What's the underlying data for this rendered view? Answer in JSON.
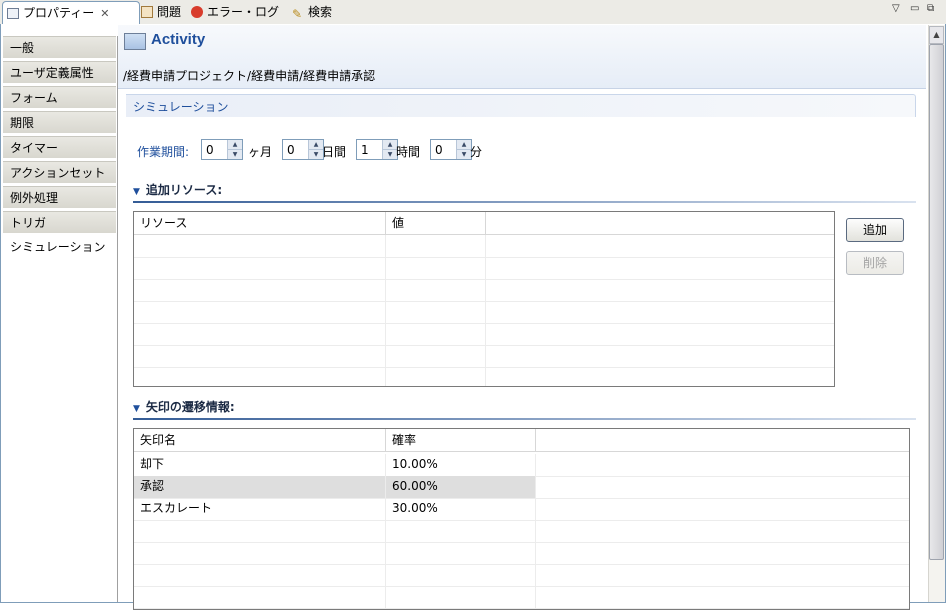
{
  "tabs": [
    {
      "label": "プロパティー",
      "icon": "properties-icon",
      "active": true,
      "closable": true
    },
    {
      "label": "問題",
      "icon": "problems-icon"
    },
    {
      "label": "エラー・ログ",
      "icon": "error-log-icon"
    },
    {
      "label": "検索",
      "icon": "search-icon"
    }
  ],
  "nav": {
    "items": [
      "一般",
      "ユーザ定義属性",
      "フォーム",
      "期限",
      "タイマー",
      "アクションセット",
      "例外処理",
      "トリガ",
      "シミュレーション"
    ],
    "selected": "シミュレーション"
  },
  "header": {
    "title": "Activity",
    "path": "/経費申請プロジェクト/経費申請/経費申請承認"
  },
  "section": {
    "title": "シミュレーション"
  },
  "duration": {
    "label": "作業期間:",
    "fields": [
      {
        "value": "0",
        "unit": "ヶ月"
      },
      {
        "value": "0",
        "unit": "日間"
      },
      {
        "value": "1",
        "unit": "時間"
      },
      {
        "value": "0",
        "unit": "分"
      }
    ]
  },
  "resources": {
    "title": "追加リソース:",
    "columns": [
      "リソース",
      "値"
    ],
    "rows": [],
    "buttons": {
      "add": "追加",
      "remove": "削除"
    }
  },
  "transitions": {
    "title": "矢印の遷移情報:",
    "columns": [
      "矢印名",
      "確率"
    ],
    "rows": [
      {
        "name": "却下",
        "prob": "10.00%"
      },
      {
        "name": "承認",
        "prob": "60.00%",
        "highlighted": true
      },
      {
        "name": "エスカレート",
        "prob": "30.00%"
      }
    ]
  },
  "colors": {
    "accent": "#1f4f9c",
    "border": "#7f9db9"
  }
}
